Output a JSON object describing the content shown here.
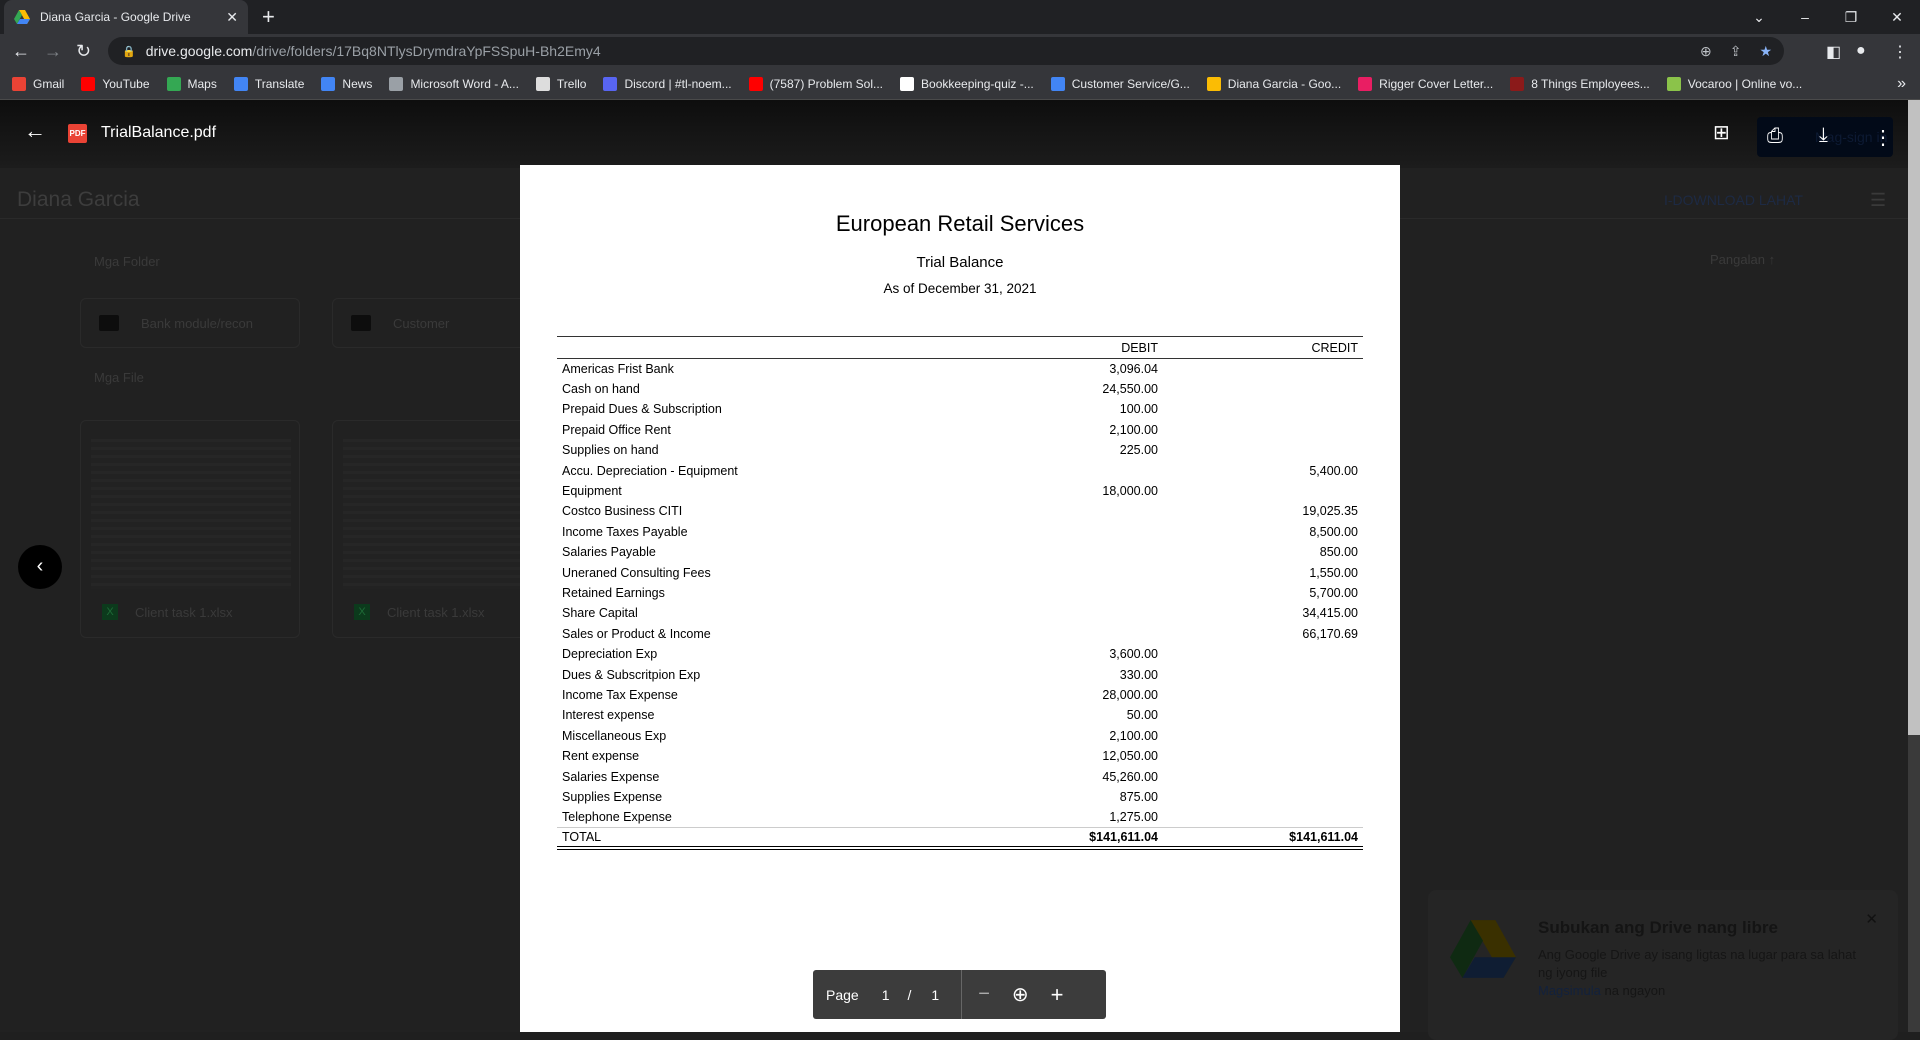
{
  "browser": {
    "tab_title": "Diana Garcia - Google Drive",
    "url_host": "drive.google.com",
    "url_path": "/drive/folders/17Bq8NTlysDrymdraYpFSSpuH-Bh2Emy4",
    "bookmarks": [
      {
        "label": "Gmail",
        "color": "#ea4335"
      },
      {
        "label": "YouTube",
        "color": "#ff0000"
      },
      {
        "label": "Maps",
        "color": "#34a853"
      },
      {
        "label": "Translate",
        "color": "#4285f4"
      },
      {
        "label": "News",
        "color": "#4285f4"
      },
      {
        "label": "Microsoft Word - A...",
        "color": "#9aa0a6"
      },
      {
        "label": "Trello",
        "color": "#dddddd"
      },
      {
        "label": "Discord | #tl-noem...",
        "color": "#5865f2"
      },
      {
        "label": "(7587) Problem Sol...",
        "color": "#ff0000"
      },
      {
        "label": "Bookkeeping-quiz -...",
        "color": "#ffffff"
      },
      {
        "label": "Customer Service/G...",
        "color": "#4285f4"
      },
      {
        "label": "Diana Garcia - Goo...",
        "color": "#fbbc04"
      },
      {
        "label": "Rigger Cover Letter...",
        "color": "#e91e63"
      },
      {
        "label": "8 Things Employees...",
        "color": "#8b1a1a"
      },
      {
        "label": "Vocaroo | Online vo...",
        "color": "#8bc34a"
      }
    ]
  },
  "viewer": {
    "file_name": "TrialBalance.pdf",
    "pdf_badge": "PDF",
    "signin_text": "Mag-sign in"
  },
  "drive": {
    "folder_title": "Diana Garcia",
    "download_all": "I-DOWNLOAD LAHAT",
    "sort_label": "Pangalan",
    "folders_heading": "Mga Folder",
    "files_heading": "Mga File",
    "folders": [
      "Bank module/recon",
      "Customer"
    ],
    "files": [
      "Client task 1.xlsx",
      "Client task 1.xlsx"
    ],
    "promo": {
      "title": "Subukan ang Drive nang libre",
      "body": "Ang Google Drive ay isang ligtas na lugar para sa lahat ng iyong file",
      "link": "Magsimula",
      "link_suffix": " na ngayon"
    }
  },
  "document": {
    "company": "European Retail Services",
    "report": "Trial Balance",
    "date": "As of December 31, 2021",
    "col_debit": "DEBIT",
    "col_credit": "CREDIT",
    "rows": [
      [
        "Americas Frist Bank",
        "3,096.04",
        ""
      ],
      [
        "Cash on hand",
        "24,550.00",
        ""
      ],
      [
        "Prepaid Dues & Subscription",
        "100.00",
        ""
      ],
      [
        "Prepaid Office Rent",
        "2,100.00",
        ""
      ],
      [
        "Supplies on hand",
        "225.00",
        ""
      ],
      [
        "Accu. Depreciation - Equipment",
        "",
        "5,400.00"
      ],
      [
        "Equipment",
        "18,000.00",
        ""
      ],
      [
        "Costco Business CITI",
        "",
        "19,025.35"
      ],
      [
        "Income Taxes Payable",
        "",
        "8,500.00"
      ],
      [
        "Salaries Payable",
        "",
        "850.00"
      ],
      [
        "Uneraned Consulting Fees",
        "",
        "1,550.00"
      ],
      [
        "Retained Earnings",
        "",
        "5,700.00"
      ],
      [
        "Share Capital",
        "",
        "34,415.00"
      ],
      [
        "Sales or Product & Income",
        "",
        "66,170.69"
      ],
      [
        "Depreciation Exp",
        "3,600.00",
        ""
      ],
      [
        "Dues & Subscritpion Exp",
        "330.00",
        ""
      ],
      [
        "Income Tax Expense",
        "28,000.00",
        ""
      ],
      [
        "Interest expense",
        "50.00",
        ""
      ],
      [
        "Miscellaneous Exp",
        "2,100.00",
        ""
      ],
      [
        "Rent expense",
        "12,050.00",
        ""
      ],
      [
        "Salaries Expense",
        "45,260.00",
        ""
      ],
      [
        "Supplies Expense",
        "875.00",
        ""
      ],
      [
        "Telephone Expense",
        "1,275.00",
        ""
      ]
    ],
    "total": {
      "label": "TOTAL",
      "debit": "$141,611.04",
      "credit": "$141,611.04"
    }
  },
  "pager": {
    "label": "Page",
    "current": "1",
    "sep": "/",
    "total": "1"
  }
}
